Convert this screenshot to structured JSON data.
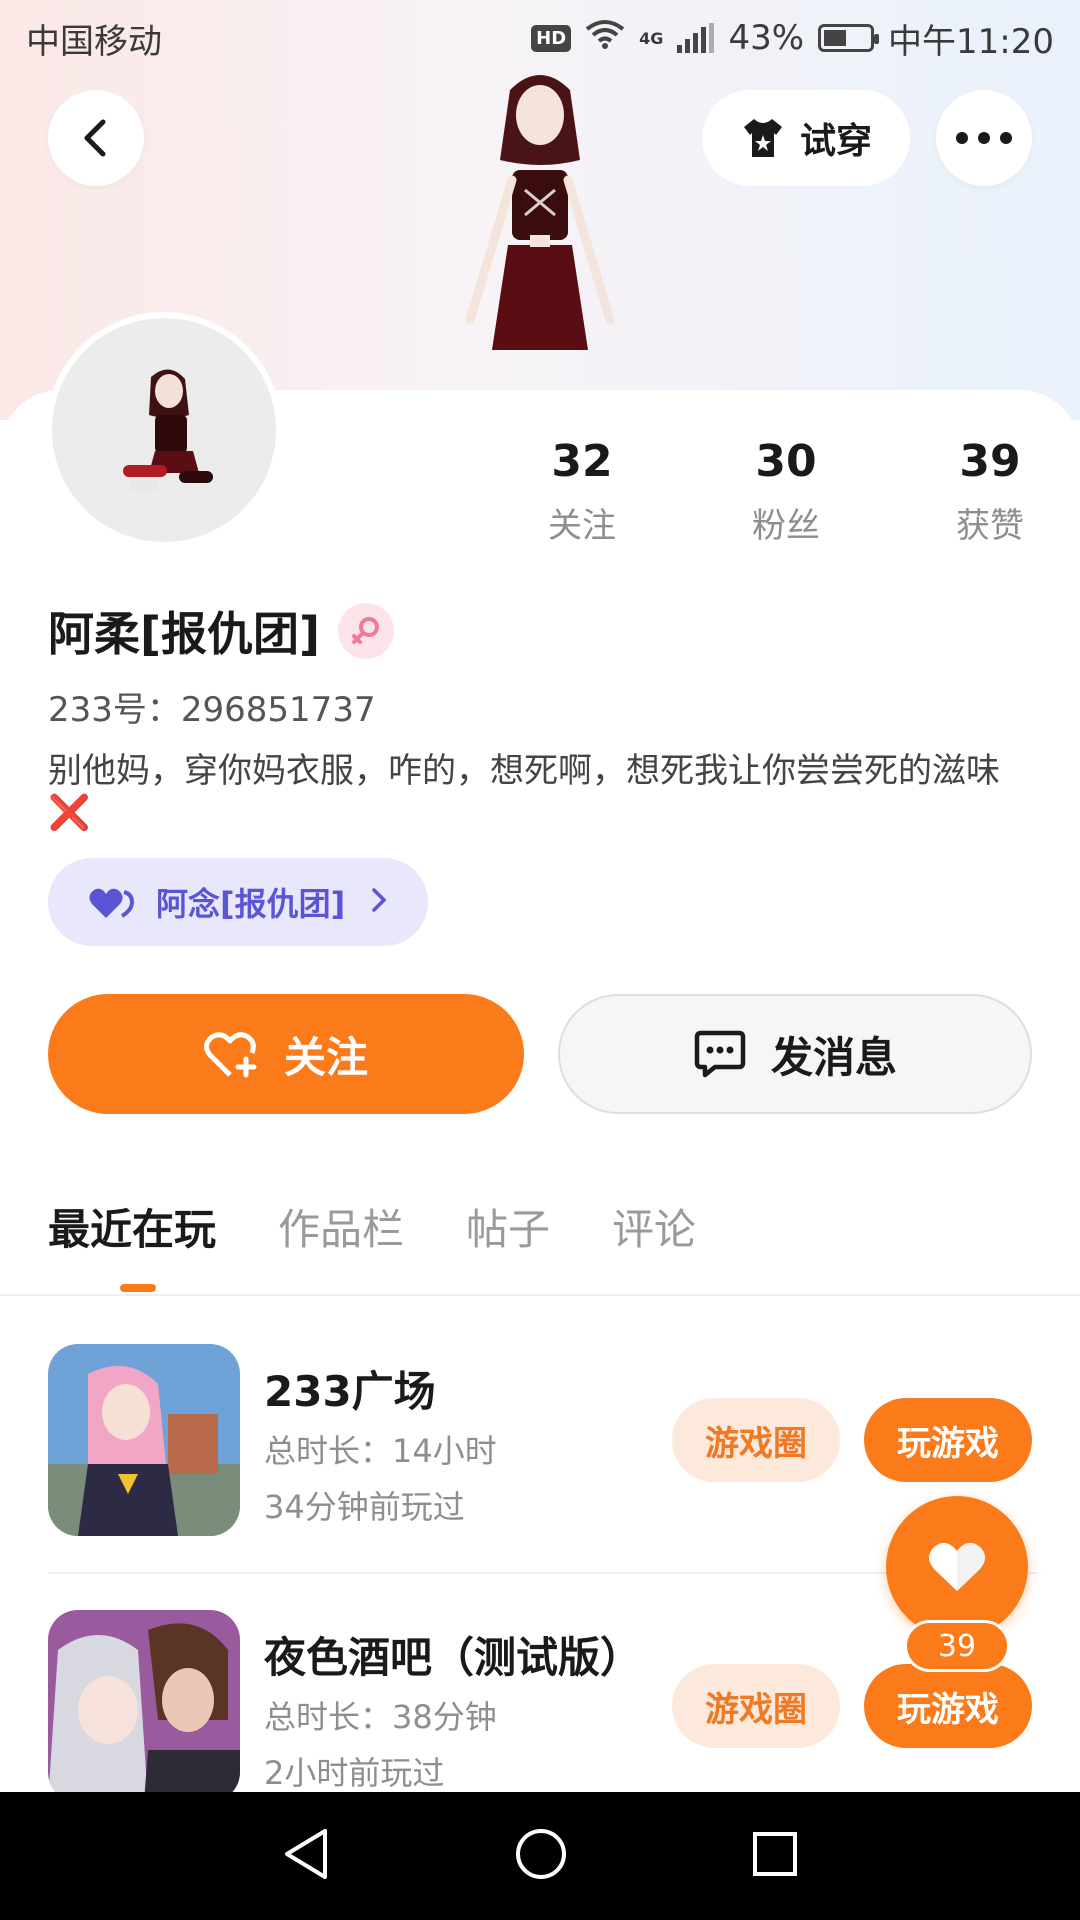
{
  "status_bar": {
    "carrier": "中国移动",
    "hd": "HD",
    "network": "4G",
    "battery": "43%",
    "time": "中午11:20"
  },
  "header": {
    "try_on_label": "试穿"
  },
  "profile": {
    "stats": [
      {
        "value": "32",
        "label": "关注"
      },
      {
        "value": "30",
        "label": "粉丝"
      },
      {
        "value": "39",
        "label": "获赞"
      }
    ],
    "name": "阿柔[报仇团]",
    "uid": "233号：296851737",
    "bio": "别他妈，穿你妈衣服，咋的，想死啊，想死我让你尝尝死的滋味",
    "bio_mark": "❌",
    "relation": "阿念[报仇团]"
  },
  "actions": {
    "follow_label": "关注",
    "message_label": "发消息"
  },
  "tabs": [
    "最近在玩",
    "作品栏",
    "帖子",
    "评论"
  ],
  "games": [
    {
      "title": "233广场",
      "duration": "总时长：14小时",
      "last_played": "34分钟前玩过",
      "circle_label": "游戏圈",
      "play_label": "玩游戏"
    },
    {
      "title": "夜色酒吧（测试版）",
      "duration": "总时长：38分钟",
      "last_played": "2小时前玩过",
      "circle_label": "游戏圈",
      "play_label": "玩游戏"
    }
  ],
  "floating_like": {
    "count": "39"
  },
  "colors": {
    "accent": "#fb7a1a",
    "relation_chip_bg": "#e8e7fb",
    "relation_chip_text": "#5b55d6"
  },
  "icons": {
    "back": "chevron-left-icon",
    "try_on": "tshirt-icon",
    "more": "more-dots-icon",
    "gender": "female-icon",
    "relation": "hearts-icon",
    "follow": "heart-plus-icon",
    "message": "chat-bubble-icon",
    "like": "heart-icon"
  }
}
